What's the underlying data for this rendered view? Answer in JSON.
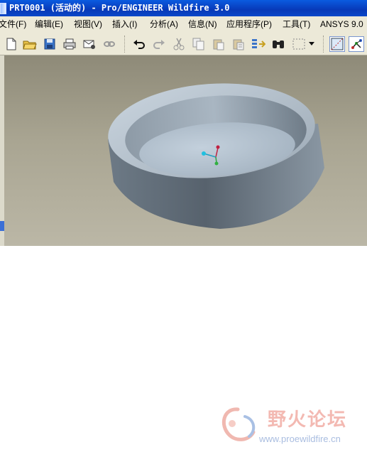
{
  "window": {
    "title": "PRT0001 (活动的) - Pro/ENGINEER Wildfire 3.0"
  },
  "menubar": {
    "items": [
      {
        "label": "文件(F)"
      },
      {
        "label": "编辑(E)"
      },
      {
        "label": "视图(V)"
      },
      {
        "label": "插入(I)"
      },
      {
        "label": "分析(A)"
      },
      {
        "label": "信息(N)"
      },
      {
        "label": "应用程序(P)"
      },
      {
        "label": "工具(T)"
      },
      {
        "label": "ANSYS 9.0"
      }
    ]
  },
  "toolbar": {
    "icons": [
      "new-file-icon",
      "open-folder-icon",
      "save-icon",
      "print-icon",
      "send-mail-icon",
      "link-icon",
      "undo-icon",
      "redo-icon",
      "cut-icon",
      "copy-icon",
      "paste-icon",
      "paste-special-icon",
      "regenerate-icon",
      "find-binoculars-icon",
      "select-box-icon",
      "dropdown-arrow-icon",
      "datum-plane-display-icon",
      "datum-axis-display-icon"
    ]
  },
  "viewport": {
    "background_top": "#8e8a78",
    "background_bottom": "#bbb7a6",
    "model_color": "#a8b8c6"
  },
  "watermark": {
    "title": "野火论坛",
    "url": "www.proewildfire.cn"
  }
}
